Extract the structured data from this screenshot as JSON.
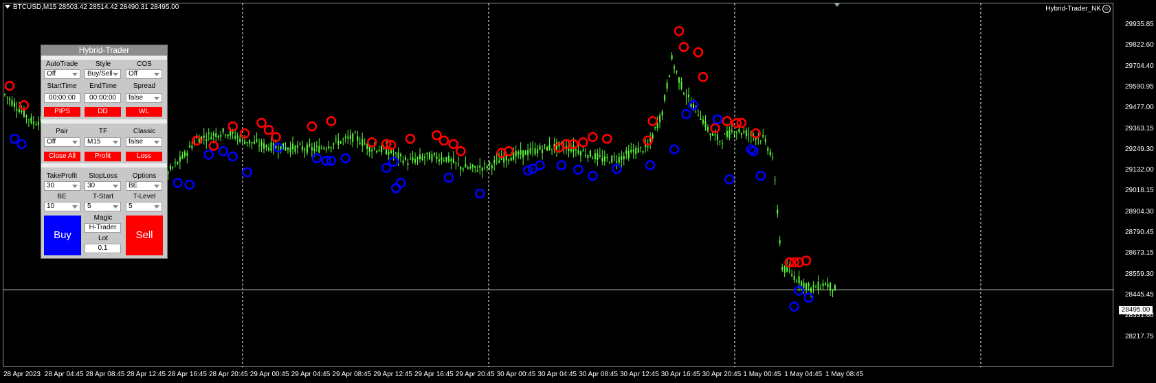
{
  "chart": {
    "symbol_line": "BTCUSD,M15  28503.42 28514.42 28490.31 28495.00",
    "indicator_name": "Hybrid-Trader_NK",
    "current_price": "28495.00",
    "colors": {
      "background": "#000000",
      "candle": "#5cff3a",
      "sell_marker": "#ff0000",
      "buy_marker": "#0000ff",
      "grid": "#cfcfcf"
    }
  },
  "chart_data": {
    "type": "candlestick",
    "y_ticks": [
      "29935.85",
      "29822.60",
      "29704.40",
      "29590.95",
      "29477.00",
      "29363.15",
      "29249.30",
      "29132.00",
      "29018.15",
      "28904.30",
      "28790.45",
      "28673.15",
      "28559.30",
      "28445.45",
      "28331.60",
      "28217.75"
    ],
    "x_ticks": [
      "28 Apr 2023",
      "28 Apr 04:45",
      "28 Apr 08:45",
      "28 Apr 12:45",
      "28 Apr 16:45",
      "28 Apr 20:45",
      "29 Apr 00:45",
      "29 Apr 04:45",
      "29 Apr 08:45",
      "29 Apr 12:45",
      "29 Apr 16:45",
      "29 Apr 20:45",
      "30 Apr 00:45",
      "30 Apr 04:45",
      "30 Apr 08:45",
      "30 Apr 12:45",
      "30 Apr 16:45",
      "30 Apr 20:45",
      "1 May 00:45",
      "1 May 04:45",
      "1 May 08:45"
    ],
    "ylim": [
      28200,
      30000
    ],
    "price_path": [
      [
        0,
        29600
      ],
      [
        6,
        29520
      ],
      [
        12,
        29440
      ],
      [
        18,
        29470
      ],
      [
        24,
        29380
      ],
      [
        30,
        29460
      ],
      [
        38,
        29520
      ],
      [
        44,
        29330
      ],
      [
        50,
        29240
      ],
      [
        56,
        29020
      ],
      [
        62,
        28950
      ],
      [
        68,
        29160
      ],
      [
        74,
        29240
      ],
      [
        80,
        29350
      ],
      [
        86,
        29370
      ],
      [
        92,
        29390
      ],
      [
        100,
        29340
      ],
      [
        108,
        29310
      ],
      [
        114,
        29300
      ],
      [
        122,
        29300
      ],
      [
        130,
        29290
      ],
      [
        138,
        29330
      ],
      [
        146,
        29360
      ],
      [
        152,
        29300
      ],
      [
        160,
        29280
      ],
      [
        168,
        29220
      ],
      [
        176,
        29250
      ],
      [
        184,
        29240
      ],
      [
        190,
        29190
      ],
      [
        196,
        29180
      ],
      [
        202,
        29200
      ],
      [
        208,
        29240
      ],
      [
        214,
        29260
      ],
      [
        220,
        29280
      ],
      [
        226,
        29300
      ],
      [
        232,
        29310
      ],
      [
        238,
        29290
      ],
      [
        244,
        29260
      ],
      [
        250,
        29230
      ],
      [
        256,
        29240
      ],
      [
        262,
        29280
      ],
      [
        268,
        29300
      ],
      [
        274,
        29500
      ],
      [
        278,
        29800
      ],
      [
        282,
        29650
      ],
      [
        286,
        29550
      ],
      [
        290,
        29480
      ],
      [
        294,
        29380
      ],
      [
        298,
        29340
      ],
      [
        304,
        29400
      ],
      [
        310,
        29380
      ],
      [
        316,
        29350
      ],
      [
        320,
        29250
      ],
      [
        324,
        28620
      ],
      [
        330,
        28560
      ],
      [
        336,
        28500
      ],
      [
        342,
        28530
      ],
      [
        346,
        28500
      ]
    ],
    "sell_markers": [
      [
        2,
        29650
      ],
      [
        8,
        29540
      ],
      [
        62,
        29300
      ],
      [
        80,
        29340
      ],
      [
        87,
        29310
      ],
      [
        95,
        29420
      ],
      [
        100,
        29380
      ],
      [
        107,
        29440
      ],
      [
        110,
        29400
      ],
      [
        113,
        29360
      ],
      [
        128,
        29420
      ],
      [
        136,
        29450
      ],
      [
        153,
        29330
      ],
      [
        159,
        29320
      ],
      [
        161,
        29315
      ],
      [
        169,
        29350
      ],
      [
        180,
        29370
      ],
      [
        183,
        29340
      ],
      [
        187,
        29320
      ],
      [
        190,
        29280
      ],
      [
        207,
        29270
      ],
      [
        210,
        29280
      ],
      [
        231,
        29300
      ],
      [
        234,
        29320
      ],
      [
        237,
        29320
      ],
      [
        241,
        29330
      ],
      [
        245,
        29360
      ],
      [
        251,
        29350
      ],
      [
        268,
        29340
      ],
      [
        270,
        29450
      ],
      [
        281,
        29960
      ],
      [
        283,
        29870
      ],
      [
        289,
        29840
      ],
      [
        291,
        29700
      ],
      [
        296,
        29410
      ],
      [
        301,
        29450
      ],
      [
        305,
        29440
      ],
      [
        307,
        29440
      ],
      [
        313,
        29380
      ],
      [
        327,
        28650
      ],
      [
        329,
        28650
      ],
      [
        331,
        28650
      ],
      [
        334,
        28660
      ]
    ],
    "buy_markers": [
      [
        4,
        29350
      ],
      [
        7,
        29320
      ],
      [
        57,
        28850
      ],
      [
        64,
        28880
      ],
      [
        72,
        29100
      ],
      [
        77,
        29090
      ],
      [
        85,
        29260
      ],
      [
        91,
        29280
      ],
      [
        95,
        29250
      ],
      [
        101,
        29160
      ],
      [
        114,
        29300
      ],
      [
        130,
        29240
      ],
      [
        134,
        29225
      ],
      [
        136,
        29225
      ],
      [
        142,
        29240
      ],
      [
        159,
        29185
      ],
      [
        162,
        29220
      ],
      [
        163,
        29070
      ],
      [
        165,
        29100
      ],
      [
        185,
        29130
      ],
      [
        198,
        29040
      ],
      [
        218,
        29170
      ],
      [
        220,
        29180
      ],
      [
        223,
        29200
      ],
      [
        232,
        29200
      ],
      [
        239,
        29175
      ],
      [
        245,
        29140
      ],
      [
        255,
        29180
      ],
      [
        269,
        29200
      ],
      [
        279,
        29290
      ],
      [
        284,
        29490
      ],
      [
        287,
        29540
      ],
      [
        297,
        29460
      ],
      [
        302,
        29120
      ],
      [
        311,
        29290
      ],
      [
        312,
        29280
      ],
      [
        315,
        29140
      ],
      [
        329,
        28400
      ],
      [
        331,
        28490
      ],
      [
        335,
        28450
      ]
    ],
    "vlines": [
      "28 Apr 20:45",
      "30 Apr 20:45"
    ]
  },
  "panel": {
    "title": "Hybrid-Trader",
    "row1_labels": [
      "AutoTrade",
      "Style",
      "COS"
    ],
    "row1_values": [
      "Off",
      "Buy/Sell",
      "Off"
    ],
    "row2_labels": [
      "StartTime",
      "EndTime",
      "Spread"
    ],
    "row2_values": [
      "00:00:00",
      "00:00:00",
      "false"
    ],
    "row3_buttons": [
      "PIPS",
      "DD",
      "WL"
    ],
    "row4_labels": [
      "Pair",
      "TF",
      "Classic"
    ],
    "row4_values": [
      "Off",
      "M15",
      "false"
    ],
    "row5_buttons": [
      "Close All",
      "Profit",
      "Loss"
    ],
    "row6_labels": [
      "TakeProfit",
      "StopLoss",
      "Options"
    ],
    "row6_values": [
      "30",
      "30",
      "BE"
    ],
    "row7_labels": [
      "BE",
      "T-Start",
      "T-Level"
    ],
    "row7_values": [
      "10",
      "5",
      "5"
    ],
    "buy_label": "Buy",
    "sell_label": "Sell",
    "magic_label": "Magic",
    "magic_value": "H-Trader",
    "lot_label": "Lot",
    "lot_value": "0.1",
    "colors": {
      "panel_bg": "#c8c8c8",
      "title_bg": "#8c8c8c",
      "buy": "#0000ff",
      "sell": "#ff0000"
    }
  }
}
